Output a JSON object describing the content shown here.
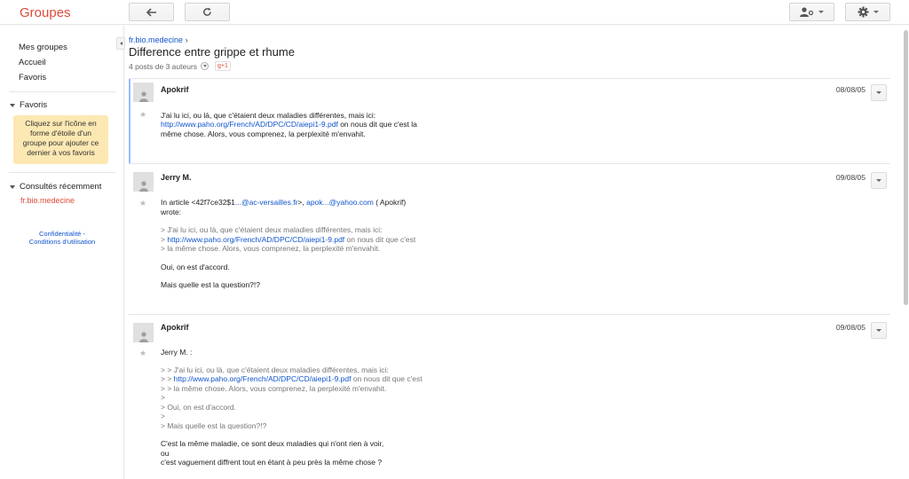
{
  "app": {
    "logo": "Groupes"
  },
  "sidebar": {
    "nav": [
      "Mes groupes",
      "Accueil",
      "Favoris"
    ],
    "favoris_header": "Favoris",
    "favoris_hint": "Cliquez sur l'icône en forme d'étoile d'un groupe pour ajouter ce dernier à vos favoris",
    "recent_header": "Consultés récemment",
    "recent_group": "fr.bio.medecine",
    "footer_line1": "Confidentialité -",
    "footer_line2": "Conditions d'utilisation"
  },
  "thread": {
    "breadcrumb": "fr.bio.medecine",
    "breadcrumb_sep": "›",
    "title": "Difference entre grippe et rhume",
    "post_count": "4 posts de 3 auteurs",
    "gplus": "g+1"
  },
  "posts": [
    {
      "author": "Apokrif",
      "date": "08/08/05",
      "lines": [
        "J'ai lu ici, ou là, que c'étaient deux maladies différentes, mais ici:",
        "même chose. Alors, vous comprenez, la perplexité m'envahit."
      ],
      "link_line": {
        "link": "http://www.paho.org/French/AD/DPC/CD/aiepi1-9.pdf",
        "suffix": " on nous dit que c'est la"
      }
    },
    {
      "author": "Jerry M.",
      "date": "09/08/05",
      "intro_prefix": "In article <42f7ce32$1",
      "intro_link1": "...@ac-versailles.fr",
      "intro_mid": ">, ",
      "intro_link2": "apok...@yahoo.com",
      "intro_suffix": " ( Apokrif)",
      "intro_line2": "wrote:",
      "quote1": "> J'ai lu ici, ou là, que c'étaient deux maladies différentes, mais ici:",
      "quote2_prefix": "> ",
      "quote2_link": "http://www.paho.org/French/AD/DPC/CD/aiepi1-9.pdf",
      "quote2_suffix": " on nous dit que c'est",
      "quote3": "> la même chose. Alors, vous comprenez, la perplexité m'envahit.",
      "reply1": "Oui, on est d'accord.",
      "reply2": "Mais quelle est la question?!?"
    },
    {
      "author": "Apokrif",
      "date": "09/08/05",
      "greeting": "Jerry M. :",
      "q1": "> > J'ai lu ici, ou là, que c'étaient deux maladies différentes, mais ici:",
      "q2_prefix": "> > ",
      "q2_link": "http://www.paho.org/French/AD/DPC/CD/aiepi1-9.pdf",
      "q2_suffix": " on nous dit que c'est",
      "q3": "> > la même chose. Alors, vous comprenez, la perplexité m'envahit.",
      "q4": ">",
      "q5": "> Oui, on est d'accord.",
      "q6": ">",
      "q7": "> Mais quelle est la question?!?",
      "r1": "C'est la même maladie, ce sont deux maladies qui n'ont rien à voir,",
      "r2": "ou",
      "r3": "c'est vaguement diffrent tout en étant à peu près la même chose ?"
    }
  ],
  "colors": {
    "brand": "#dd4b39",
    "link": "#1155cc",
    "fav_bg": "#fce8b2"
  }
}
